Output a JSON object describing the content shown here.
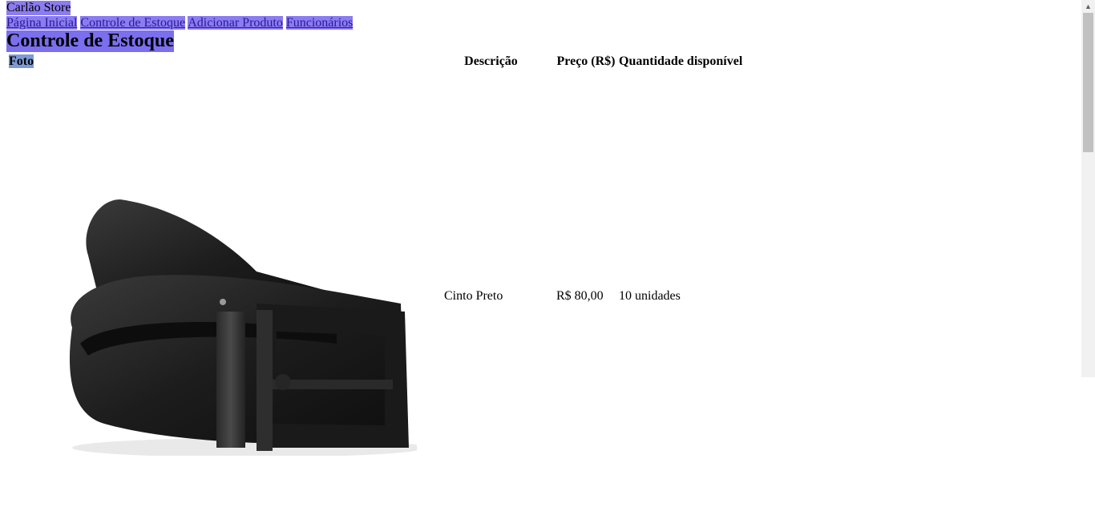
{
  "header": {
    "store_name": "Carlão Store"
  },
  "nav": {
    "items": [
      {
        "label": "Página Inicial"
      },
      {
        "label": "Controle de Estoque"
      },
      {
        "label": "Adicionar Produto"
      },
      {
        "label": "Funcionários"
      }
    ]
  },
  "main": {
    "title": "Controle de Estoque",
    "table": {
      "headers": [
        "Foto",
        "Descrição",
        "Preço (R$)",
        "Quantidade disponível"
      ],
      "rows": [
        {
          "photo_icon": "black-belt-image",
          "description": "Cinto Preto",
          "price": "R$ 80,00",
          "quantity": "10 unidades"
        }
      ]
    }
  },
  "colors": {
    "highlight": "#8b7cf0",
    "header_highlight": "#7b9ad6"
  }
}
